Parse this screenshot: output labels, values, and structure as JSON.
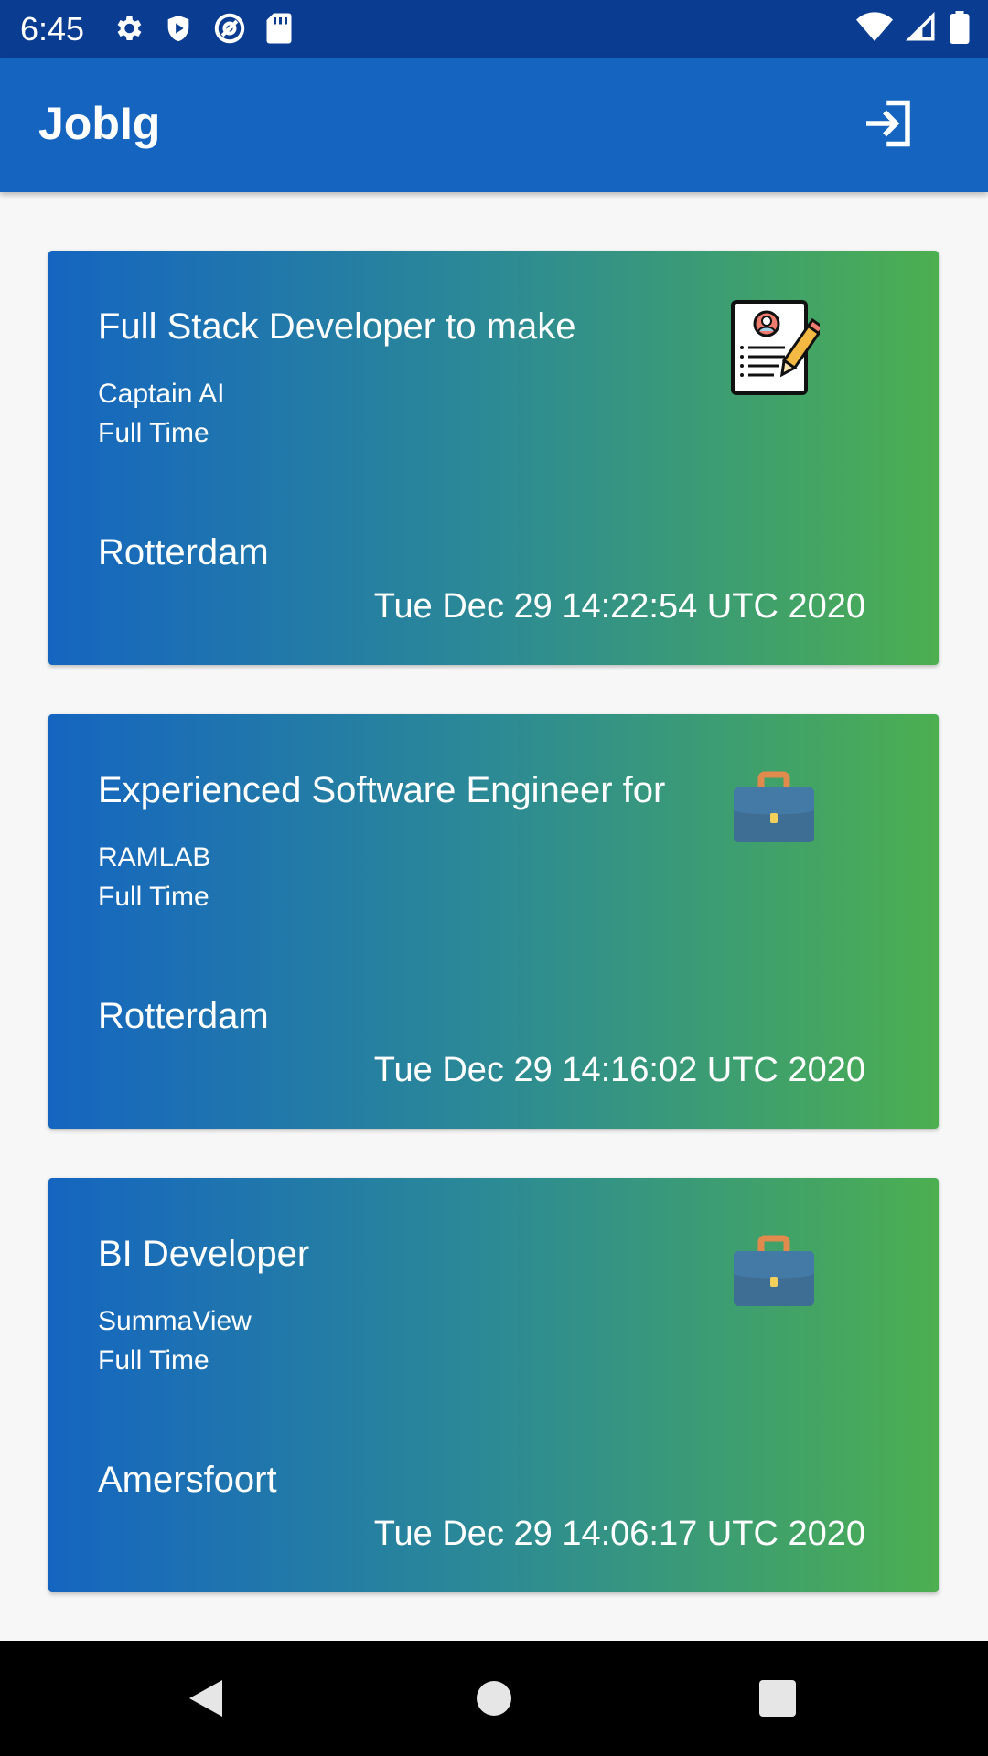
{
  "status_bar": {
    "time": "6:45",
    "icons_left": [
      "gear-icon",
      "shield-icon",
      "at-sign-icon",
      "sd-card-icon"
    ],
    "icons_right": [
      "wifi-icon",
      "signal-icon",
      "battery-icon"
    ]
  },
  "app_bar": {
    "title": "JobIg",
    "action_icon": "login-icon"
  },
  "jobs": [
    {
      "title": "Full Stack Developer to make",
      "company": "Captain AI",
      "type": "Full Time",
      "location": "Rotterdam",
      "date": "Tue Dec 29 14:22:54 UTC 2020",
      "icon": "resume-icon"
    },
    {
      "title": "Experienced Software Engineer for",
      "company": "RAMLAB",
      "type": "Full Time",
      "location": "Rotterdam",
      "date": "Tue Dec 29 14:16:02 UTC 2020",
      "icon": "briefcase-icon"
    },
    {
      "title": "BI Developer",
      "company": "SummaView",
      "type": "Full Time",
      "location": "Amersfoort",
      "date": "Tue Dec 29 14:06:17 UTC 2020",
      "icon": "briefcase-icon"
    }
  ],
  "colors": {
    "status_bar": "#0a3d91",
    "app_bar": "#1565c0",
    "gradient_start": "#1565c0",
    "gradient_end": "#4caf50",
    "nav_bar": "#000000"
  },
  "nav_bar": {
    "buttons": [
      "back-icon",
      "home-icon",
      "recents-icon"
    ]
  }
}
